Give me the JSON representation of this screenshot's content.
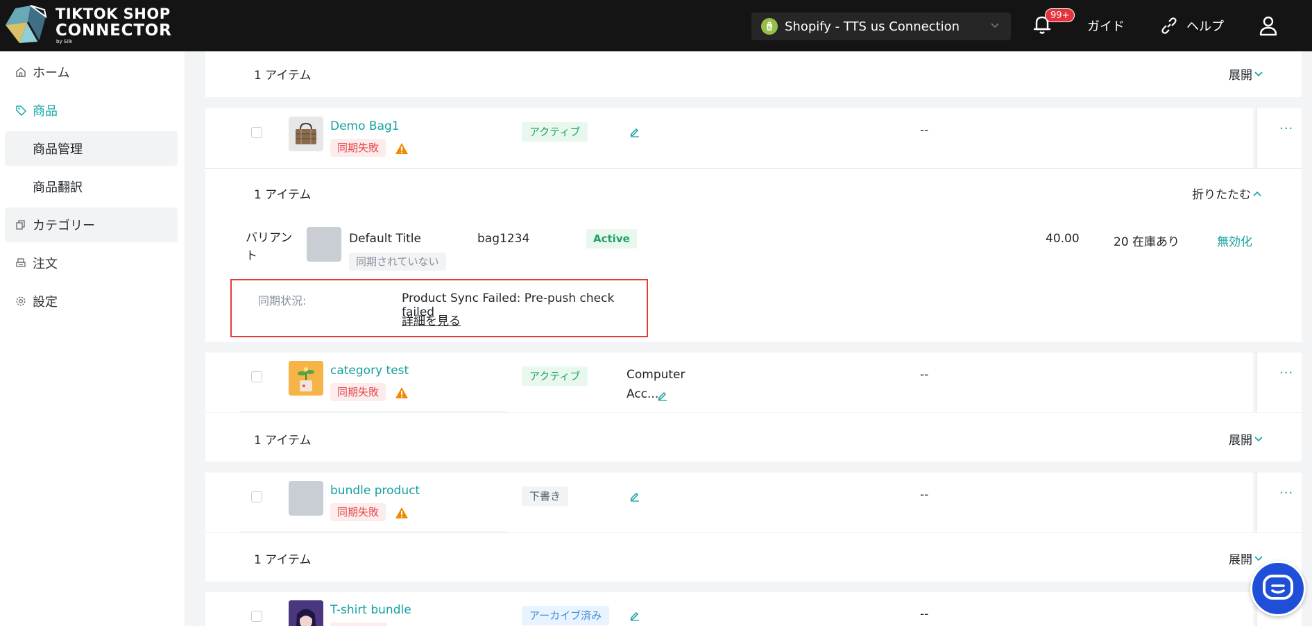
{
  "header": {
    "logo": {
      "line1": "TIKTOK SHOP",
      "line2": "CONNECTOR",
      "line3": "by Silk"
    },
    "connection": {
      "label": "Shopify - TTS us Connection"
    },
    "notifications": {
      "badge": "99+"
    },
    "guide_label": "ガイド",
    "help_label": "ヘルプ"
  },
  "sidebar": {
    "home": "ホーム",
    "products": "商品",
    "product_management": "商品管理",
    "product_translation": "商品翻訳",
    "category": "カテゴリー",
    "orders": "注文",
    "settings": "設定"
  },
  "colors": {
    "accent": "#13a0a0",
    "header_bg": "#141414",
    "fail": "#e5484d",
    "success": "#20a162"
  },
  "groups": [
    {
      "title": "1 アイテム",
      "toggle": "展開"
    },
    {
      "title": "1 アイテム",
      "toggle": "折りたたむ"
    },
    {
      "title": "1 アイテム",
      "toggle": "展開"
    },
    {
      "title": "1 アイテム",
      "toggle": "展開"
    }
  ],
  "products": [
    {
      "name": "Demo Bag1",
      "sync": "同期失敗",
      "status": "アクティブ",
      "category": "",
      "price": "--"
    },
    {
      "name": "category test",
      "sync": "同期失敗",
      "status": "アクティブ",
      "category_line1": "Computer",
      "category_line2": "Acc...",
      "price": "--"
    },
    {
      "name": "bundle product",
      "sync": "同期失敗",
      "status": "下書き",
      "category": "",
      "price": "--"
    },
    {
      "name": "T-shirt bundle",
      "status": "アーカイブ済み",
      "category": "",
      "price": "--"
    }
  ],
  "variant": {
    "label": "バリアント",
    "title": "Default Title",
    "sync": "同期されていない",
    "sku": "bag1234",
    "status": "Active",
    "price": "40.00",
    "stock": "20 在庫あり",
    "action": "無効化"
  },
  "sync_status": {
    "label": "同期状況:",
    "message": "Product Sync Failed: Pre-push check failed",
    "details_link": "詳細を見る"
  }
}
